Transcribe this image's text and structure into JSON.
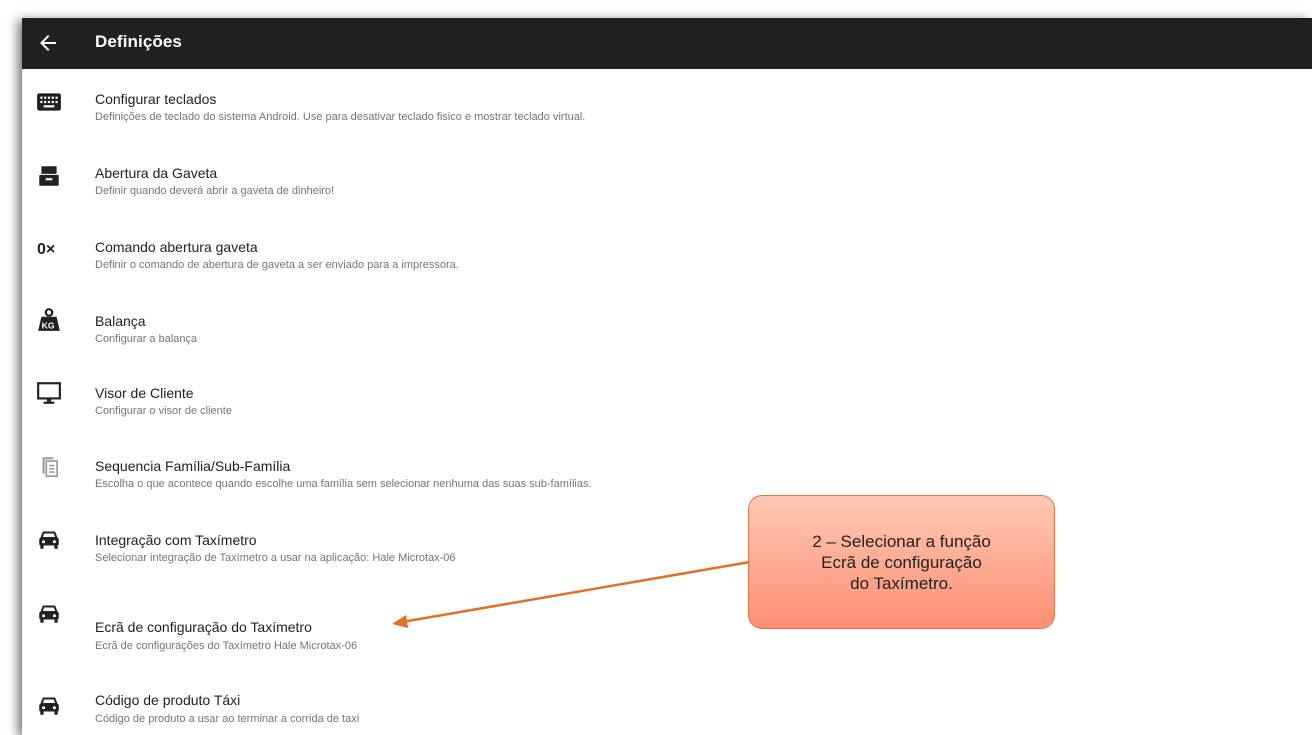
{
  "appbar": {
    "title": "Definições"
  },
  "items": [
    {
      "icon": "keyboard-icon",
      "title": "Configurar teclados",
      "subtitle": "Definições de teclado do sistema Android. Use para desativar teclado fisico e mostrar teclado virtual."
    },
    {
      "icon": "cash-drawer-icon",
      "title": "Abertura da Gaveta",
      "subtitle": "Definir quando deverá abrir a gaveta de dinheiro!"
    },
    {
      "icon": "hex-code-icon",
      "title": "Comando abertura gaveta",
      "subtitle": "Definir o comando de abertura de gaveta a ser enviado para a impressora."
    },
    {
      "icon": "scale-weight-icon",
      "title": "Balança",
      "subtitle": "Configurar a balança"
    },
    {
      "icon": "monitor-icon",
      "title": "Visor de Cliente",
      "subtitle": "Configurar o visor de cliente"
    },
    {
      "icon": "copy-document-icon",
      "title": "Sequencia Família/Sub-Família",
      "subtitle": "Escolha o que acontece quando escolhe uma família sem selecionar nenhuma das suas sub-famílias."
    },
    {
      "icon": "taxi-icon",
      "title": "Integração com Taxímetro",
      "subtitle": "Selecionar integração de Taxímetro a usar na aplicação: Hale Microtax-06"
    },
    {
      "icon": "taxi-icon",
      "title": "Ecrã de configuração do Taxímetro",
      "subtitle": "Ecrã de configurações do Taxímetro Hale Microtax-06"
    },
    {
      "icon": "taxi-icon",
      "title": "Código de produto Táxi",
      "subtitle": "Código de produto a usar ao terminar a corrida de taxi"
    }
  ],
  "callout": {
    "line1": "2 – Selecionar a função",
    "line2": "Ecrã de configuração",
    "line3": "do Taxímetro."
  },
  "colors": {
    "appbar": "#212121",
    "callout_fill": "#ff9a80",
    "arrow": "#e0702a"
  }
}
